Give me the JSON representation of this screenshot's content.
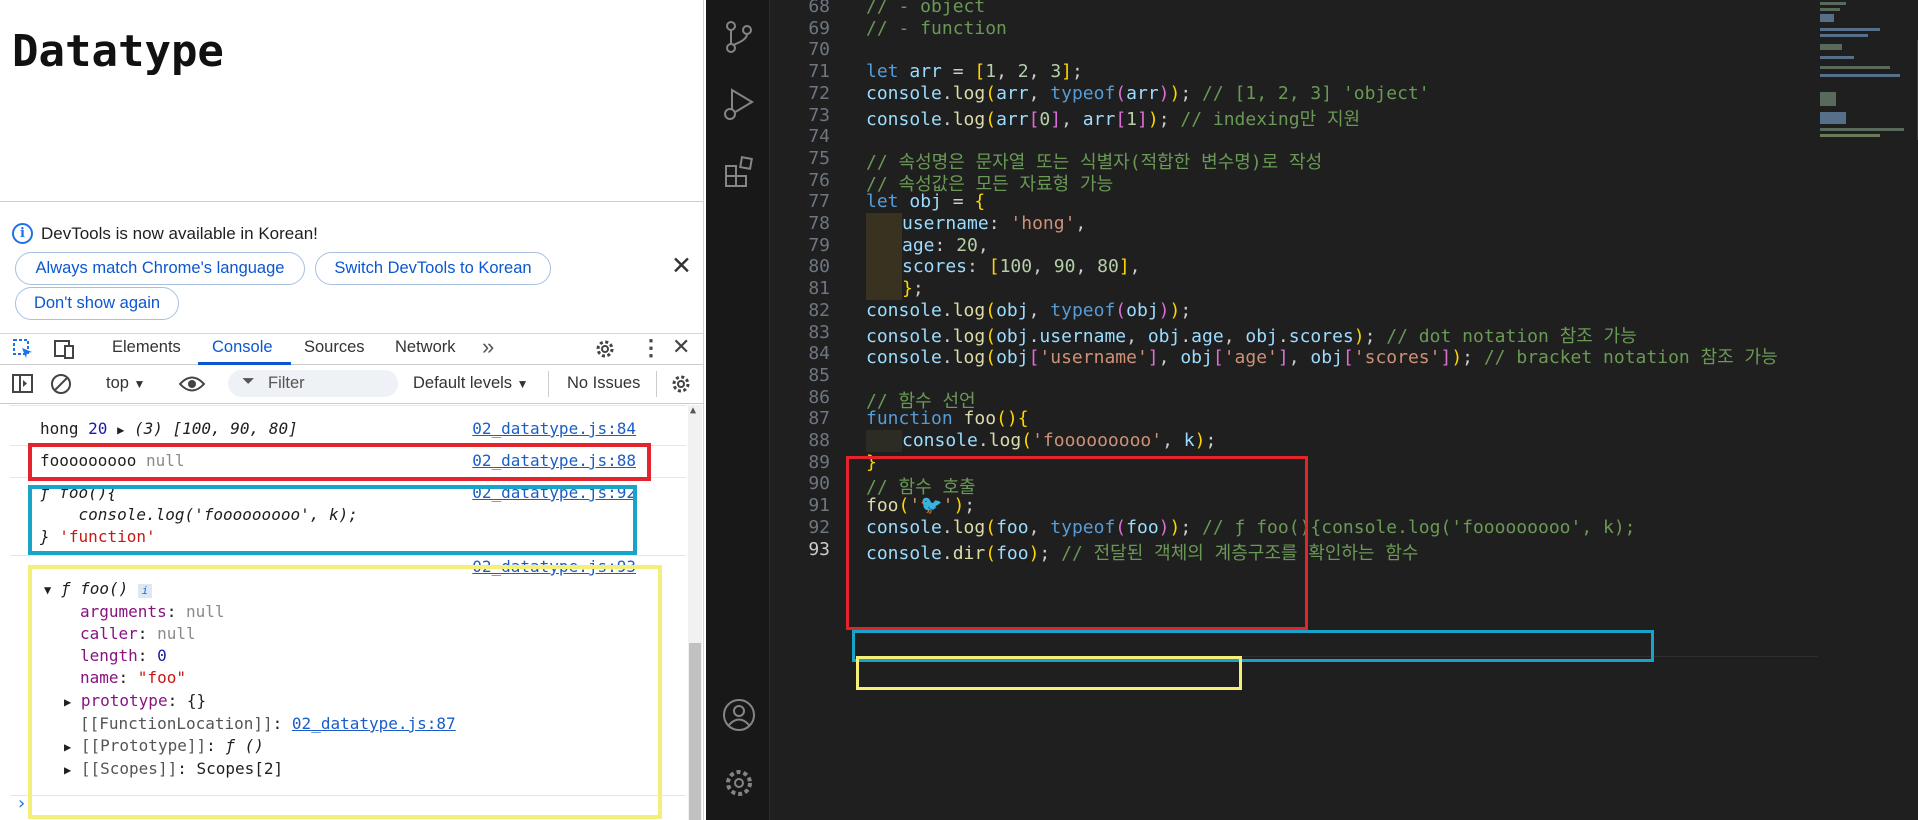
{
  "page": {
    "title": "Datatype"
  },
  "infobar": {
    "message": "DevTools is now available in Korean!",
    "btn_match": "Always match Chrome's language",
    "btn_switch": "Switch DevTools to Korean",
    "btn_dont": "Don't show again"
  },
  "tabs": {
    "elements": "Elements",
    "console": "Console",
    "sources": "Sources",
    "network": "Network"
  },
  "toolbar": {
    "context": "top",
    "filter_placeholder": "Filter",
    "levels": "Default levels",
    "issues": "No Issues"
  },
  "console": {
    "row1": {
      "a": "hong",
      "b": "20",
      "c": "(3) [100, 90, 80]",
      "src": "02_datatype.js:84"
    },
    "row2": {
      "a": "fooooooooo",
      "b": "null",
      "src": "02_datatype.js:88"
    },
    "row3": {
      "l1": "ƒ foo(){",
      "l2": "    console.log('fooooooooo', k);",
      "l3a": "}",
      "l3b": "'function'",
      "src": "02_datatype.js:92"
    },
    "row4": {
      "src": "02_datatype.js:93",
      "head": "ƒ foo()",
      "props": [
        {
          "k": "arguments",
          "v": "null"
        },
        {
          "k": "caller",
          "v": "null"
        },
        {
          "k": "length",
          "v": "0"
        },
        {
          "k": "name",
          "v": "\"foo\""
        },
        {
          "k": "prototype",
          "v": "{}"
        }
      ],
      "funcloc_key": "[[FunctionLocation]]",
      "funcloc_val": "02_datatype.js:87",
      "proto_key": "[[Prototype]]",
      "proto_val": "ƒ ()",
      "scopes_key": "[[Scopes]]",
      "scopes_val": "Scopes[2]"
    }
  },
  "editor": {
    "lines": [
      {
        "n": "68",
        "t": "// - object"
      },
      {
        "n": "69",
        "t": "// - function"
      },
      {
        "n": "70",
        "t": ""
      },
      {
        "n": "71",
        "t": "let arr = [1, 2, 3];"
      },
      {
        "n": "72",
        "t": "console.log(arr, typeof(arr)); // [1, 2, 3] 'object'"
      },
      {
        "n": "73",
        "t": "console.log(arr[0], arr[1]); // indexing만 지원"
      },
      {
        "n": "74",
        "t": ""
      },
      {
        "n": "75",
        "t": "// 속성명은 문자열 또는 식별자(적합한 변수명)로 작성"
      },
      {
        "n": "76",
        "t": "// 속성값은 모든 자료형 가능"
      },
      {
        "n": "77",
        "t": "let obj = {"
      },
      {
        "n": "78",
        "t": "username: 'hong',"
      },
      {
        "n": "79",
        "t": "age: 20,"
      },
      {
        "n": "80",
        "t": "scores: [100, 90, 80],"
      },
      {
        "n": "81",
        "t": "};"
      },
      {
        "n": "82",
        "t": "console.log(obj, typeof(obj));"
      },
      {
        "n": "83",
        "t": "console.log(obj.username, obj.age, obj.scores); // dot notation 참조 가능"
      },
      {
        "n": "84",
        "t": "console.log(obj['username'], obj['age'], obj['scores']); // bracket notation 참조 가능"
      },
      {
        "n": "85",
        "t": ""
      },
      {
        "n": "86",
        "t": "// 함수 선언"
      },
      {
        "n": "87",
        "t": "function foo(){"
      },
      {
        "n": "88",
        "t": "console.log('fooooooooo', k);"
      },
      {
        "n": "89",
        "t": "}"
      },
      {
        "n": "90",
        "t": "// 함수 호출"
      },
      {
        "n": "91",
        "t": "foo('🐦');"
      },
      {
        "n": "92",
        "t": "console.log(foo, typeof(foo)); // ƒ foo(){console.log('fooooooooo', k);"
      },
      {
        "n": "93",
        "t": "console.dir(foo); // 전달된 객체의 계층구조를 확인하는 함수"
      }
    ]
  },
  "colors": {
    "red": "#e3242b",
    "cyan": "#1aa3c9",
    "yellow": "#f4ef78"
  }
}
